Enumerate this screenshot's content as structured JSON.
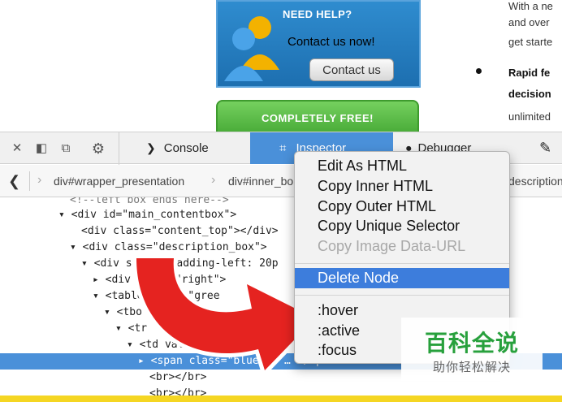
{
  "webpage": {
    "help_title": "NEED HELP?",
    "help_text": "Contact us now!",
    "contact_button": "Contact us",
    "free_text": "COMPLETELY FREE!",
    "side_lines": [
      "With a ne",
      "and over",
      "get starte"
    ],
    "side_bold_lines": [
      "Rapid fe",
      "decision"
    ],
    "side_line_last": "unlimited"
  },
  "toolbar": {
    "close_icon": "✕",
    "dock_side_icon": "◧",
    "split_icon": "⧉",
    "gear_icon": "⚙",
    "console_icon": "❯",
    "console": "Console",
    "inspector_icon": "⌗",
    "inspector": "Inspector",
    "debugger_icon": "⏺",
    "debugger": "Debugger",
    "style_icon": "✎"
  },
  "breadcrumbs": {
    "back_icon": "❮",
    "items": [
      "div#wrapper_presentation",
      "div#inner_bo",
      "description"
    ]
  },
  "markup": {
    "lines": [
      "<!--left box ends here-->",
      "<div id=\"main_contentbox\">",
      "<div class=\"content_top\"></div>",
      "<div class=\"description_box\">",
      "<div style=\"padding-left: 20p",
      "<div align=\"right\">",
      "<table class=\"gree",
      "<tbo",
      "<tr",
      "<td valig",
      "<span class=\"blue12\" … </span>",
      "<br></br>",
      "<br></br>"
    ]
  },
  "context_menu": {
    "items": [
      "Edit As HTML",
      "Copy Inner HTML",
      "Copy Outer HTML",
      "Copy Unique Selector",
      "Copy Image Data-URL",
      "Delete Node",
      ":hover",
      ":active",
      ":focus"
    ]
  },
  "watermark": {
    "title": "百科全说",
    "subtitle": "助你轻松解决"
  },
  "colors": {
    "inspector_tab": "#4a90d9",
    "menu_highlight": "#3d7ddc",
    "arrow_red": "#e52320",
    "bottom_bar": "#f5d623"
  }
}
